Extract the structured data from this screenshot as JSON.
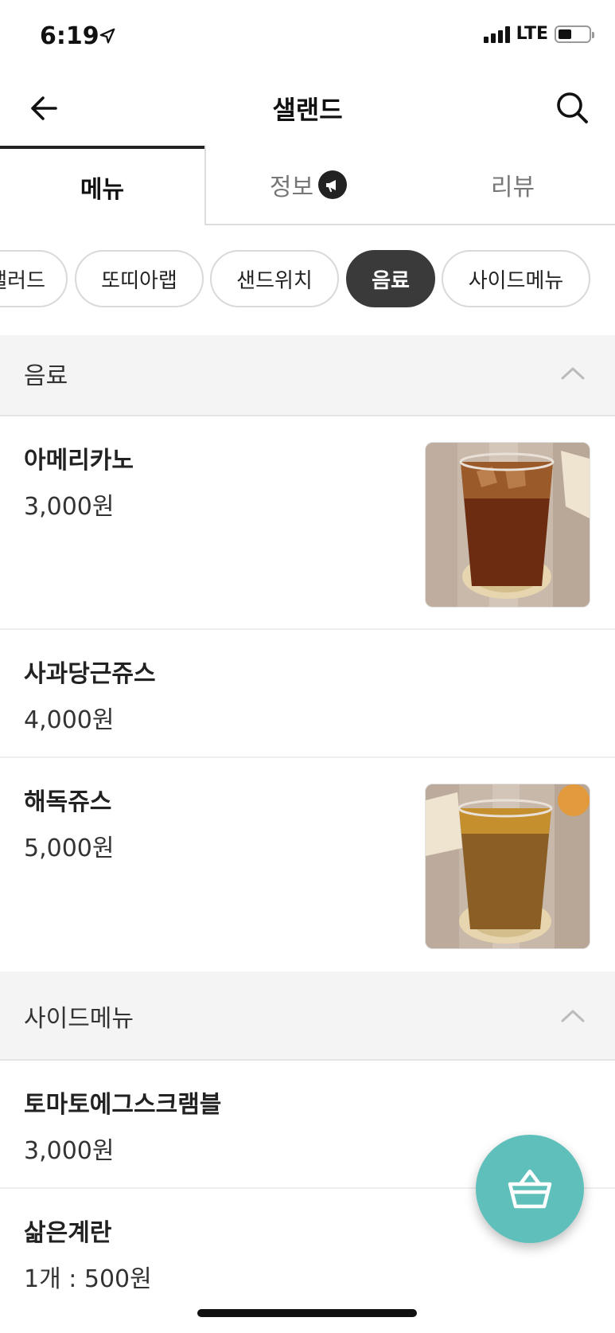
{
  "status_bar": {
    "time": "6:19",
    "network": "LTE"
  },
  "header": {
    "title": "샐랜드"
  },
  "tabs": [
    {
      "label": "메뉴"
    },
    {
      "label": "정보"
    },
    {
      "label": "리뷰"
    }
  ],
  "categories": [
    "샐러드",
    "또띠아랩",
    "샌드위치",
    "음료",
    "사이드메뉴"
  ],
  "selected_category": "음료",
  "sections": [
    {
      "title": "음료",
      "items": [
        {
          "name": "아메리카노",
          "price": "3,000원",
          "image": "iced-americano-photo"
        },
        {
          "name": "사과당근쥬스",
          "price": "4,000원"
        },
        {
          "name": "해독쥬스",
          "price": "5,000원",
          "image": "detox-juice-photo"
        }
      ]
    },
    {
      "title": "사이드메뉴",
      "items": [
        {
          "name": "토마토에그스크램블",
          "price": "3,000원"
        },
        {
          "name": "삶은계란",
          "price": "1개 : 500원"
        }
      ]
    }
  ],
  "colors": {
    "accent": "#5fc0bb",
    "chip_active": "#3a3a3a",
    "section_bg": "#f4f4f4"
  },
  "icons": [
    "back-arrow-icon",
    "search-icon",
    "megaphone-icon",
    "chevron-up-icon",
    "basket-icon",
    "location-arrow-icon"
  ]
}
